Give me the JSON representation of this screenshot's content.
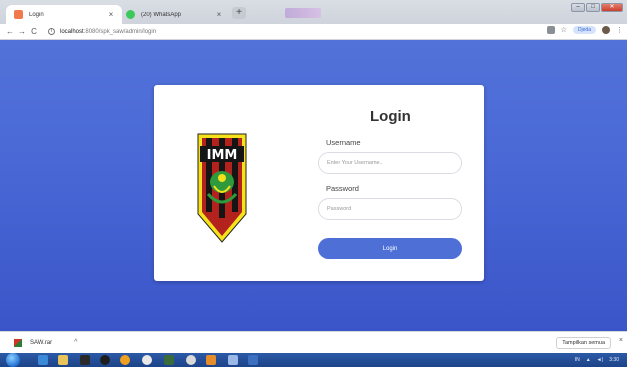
{
  "browser": {
    "tabs": [
      {
        "title": "Login",
        "close": "×",
        "favicon_color": "#f2794c"
      },
      {
        "title": "(20) WhatsApp",
        "close": "×",
        "favicon_color": "#3cc85a"
      }
    ],
    "new_tab_glyph": "+",
    "window_controls": {
      "minimize": "–",
      "maximize": "□",
      "close": "✕"
    },
    "nav": {
      "back": "←",
      "forward": "→",
      "reload": "C"
    },
    "address": {
      "host": "localhost",
      "path": ":8080/spk_saw/admin/login"
    },
    "profile_label": "Djeda",
    "menu_glyph": "⋮",
    "star_glyph": "☆"
  },
  "page": {
    "logo_text": "IMM",
    "heading": "Login",
    "username_label": "Username",
    "username_placeholder": "Enter Your Username..",
    "password_label": "Password",
    "password_placeholder": "Password",
    "submit_label": "Login",
    "accent_color": "#4d6fd6"
  },
  "downloads": {
    "file_name": "SAW.rar",
    "chevron": "^",
    "show_all_label": "Tampilkan semua",
    "close": "×"
  },
  "taskbar": {
    "lang": "IN",
    "time": "3:30"
  }
}
